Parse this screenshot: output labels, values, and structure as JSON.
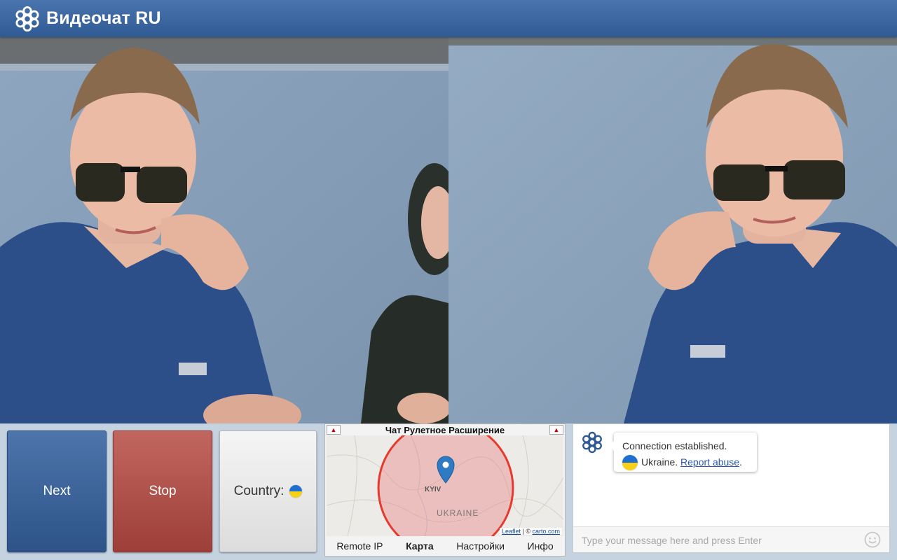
{
  "header": {
    "title": "Видеочат RU"
  },
  "controls": {
    "next_label": "Next",
    "stop_label": "Stop",
    "country_label": "Country:",
    "country_flag": "Ukraine flag"
  },
  "map_panel": {
    "title": "Чат Рулетное Расширение",
    "city_label": "KYIV",
    "country_label": "UKRAINE",
    "attribution_leaflet": "Leaflet",
    "attribution_sep": " | © ",
    "attribution_carto": "carto.com",
    "tabs": [
      {
        "label": "Remote IP",
        "active": false
      },
      {
        "label": "Карта",
        "active": true
      },
      {
        "label": "Настройки",
        "active": false
      },
      {
        "label": "Инфо",
        "active": false
      }
    ]
  },
  "chat": {
    "message_line1": "Connection established.",
    "country": "Ukraine.",
    "report_link": "Report abuse",
    "report_suffix": ".",
    "input_placeholder": "Type your message here and press Enter"
  },
  "colors": {
    "header": "#3a64a0",
    "next_button": "#3d649c",
    "stop_button": "#af524b",
    "map_circle": "#e53a2e"
  }
}
